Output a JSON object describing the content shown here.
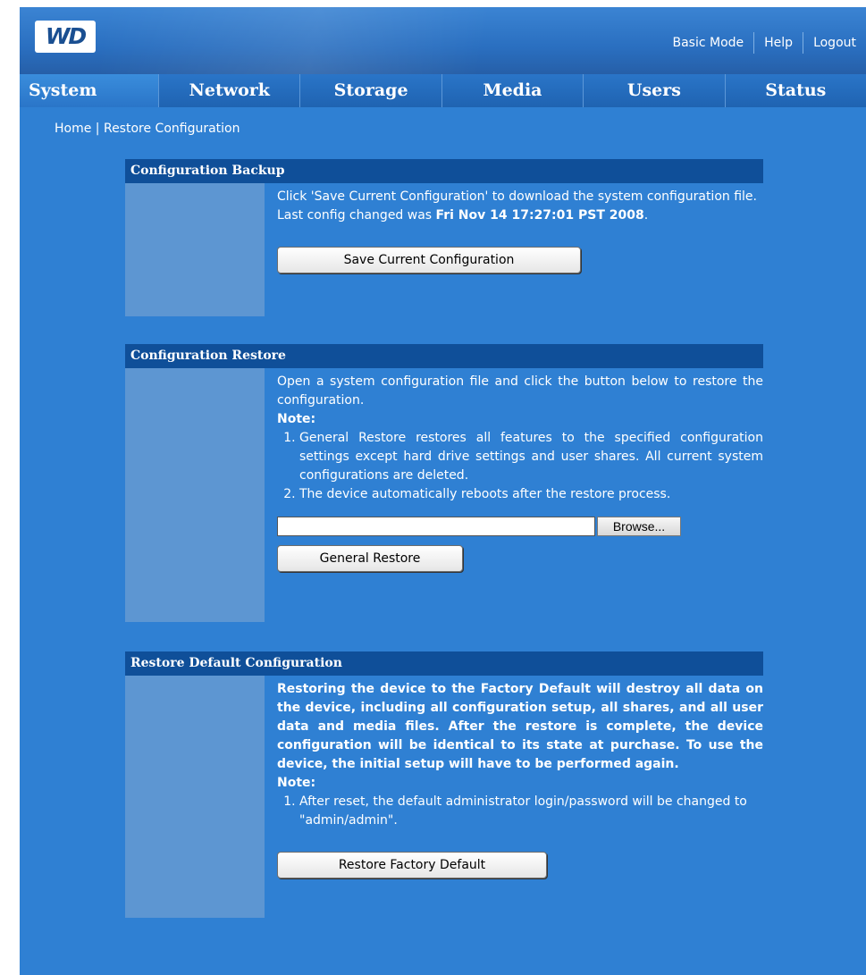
{
  "header": {
    "logo_text": "WD",
    "links": [
      "Basic Mode",
      "Help",
      "Logout"
    ]
  },
  "nav": {
    "tabs": [
      "System",
      "Network",
      "Storage",
      "Media",
      "Users",
      "Status"
    ]
  },
  "breadcrumb": {
    "home": "Home",
    "separator": "|",
    "current": "Restore Configuration"
  },
  "backup": {
    "title": "Configuration Backup",
    "text": "Click 'Save Current Configuration' to download the system configuration file.",
    "last_changed_prefix": "Last config changed was ",
    "last_changed_value": "Fri Nov 14 17:27:01 PST 2008",
    "last_changed_suffix": ".",
    "button": "Save Current Configuration"
  },
  "restore": {
    "title": "Configuration Restore",
    "text": "Open a system configuration file and click the button below to restore the configuration.",
    "note_label": "Note:",
    "notes": [
      "General Restore restores all features to the specified configuration settings except hard drive settings and user shares. All current system configurations are deleted.",
      "The device automatically reboots after the restore process."
    ],
    "file_value": "",
    "browse_button": "Browse...",
    "button": "General Restore"
  },
  "factory": {
    "title": "Restore Default Configuration",
    "warning": "Restoring the device to the Factory Default will destroy all data on the device, including all configuration setup, all shares, and all user data and media files. After the restore is complete, the device configuration will be identical to its state at purchase. To use the device, the initial setup will have to be performed again.",
    "note_label": "Note:",
    "notes": [
      "After reset, the default administrator login/password will be changed to \"admin/admin\"."
    ],
    "button": "Restore Factory Default"
  }
}
